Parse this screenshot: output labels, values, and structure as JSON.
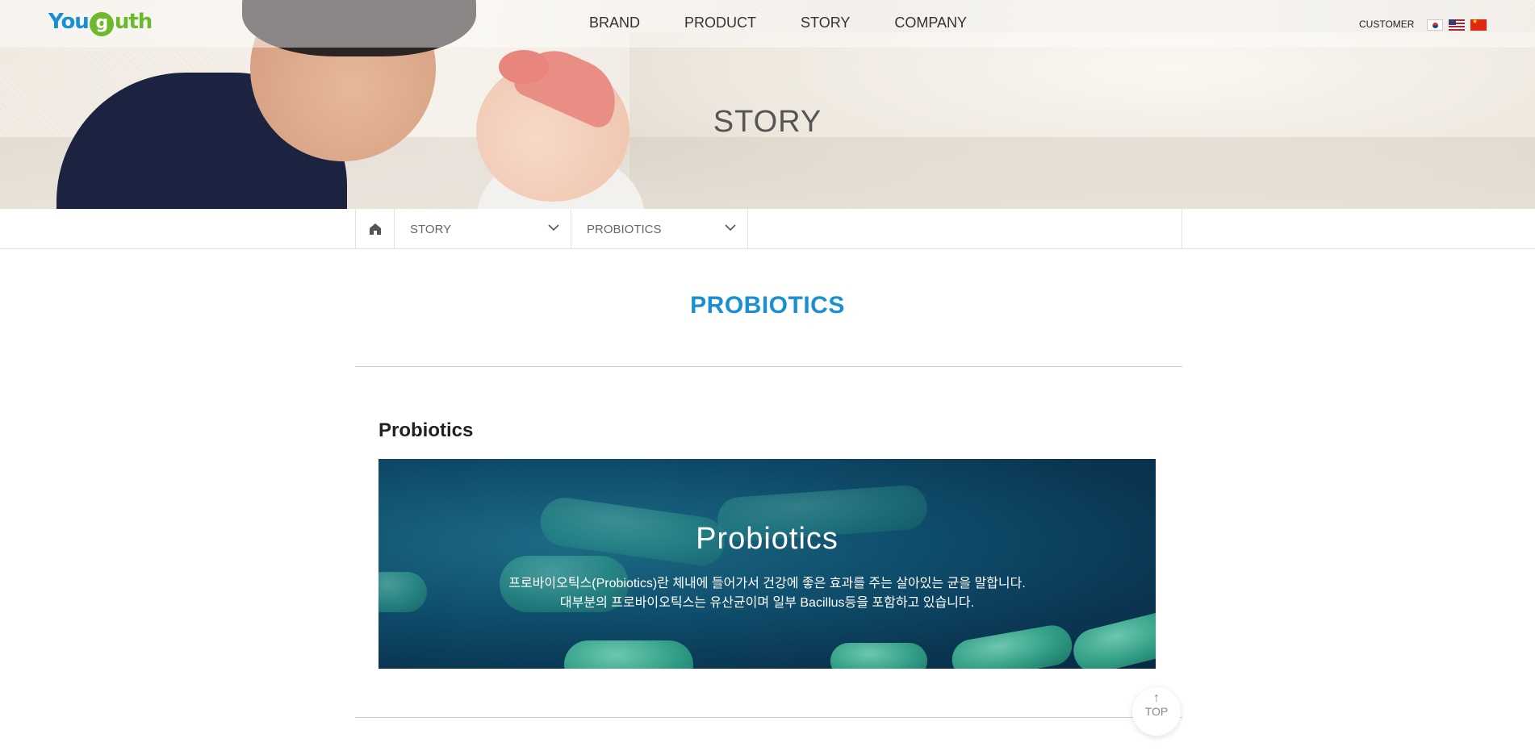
{
  "header": {
    "logo": {
      "you": "You",
      "g": "g",
      "uth": "uth"
    },
    "nav": [
      "BRAND",
      "PRODUCT",
      "STORY",
      "COMPANY"
    ],
    "customer": "CUSTOMER",
    "flags": [
      "kr-flag-icon",
      "us-flag-icon",
      "cn-flag-icon"
    ]
  },
  "hero": {
    "title": "STORY"
  },
  "breadcrumb": {
    "home_icon": "home-icon",
    "level1": "STORY",
    "level2": "PROBIOTICS"
  },
  "page": {
    "title": "PROBIOTICS",
    "section_heading": "Probiotics",
    "banner": {
      "title": "Probiotics",
      "line1": "프로바이오틱스(Probiotics)란 체내에 들어가서 건강에 좋은 효과를 주는 살아있는 균을 말합니다.",
      "line2": "대부분의 프로바이오틱스는 유산균이며 일부 Bacillus등을 포함하고 있습니다."
    }
  },
  "top_button": {
    "label": "TOP",
    "icon": "arrow-up-icon"
  },
  "colors": {
    "accent": "#1a8fd2",
    "logo_green": "#6cba2c"
  }
}
